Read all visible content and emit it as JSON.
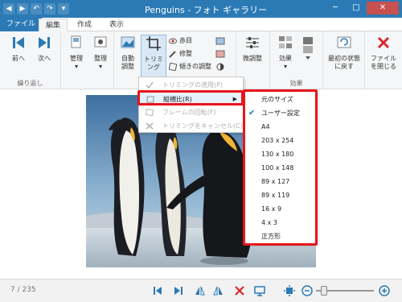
{
  "window": {
    "title": "Penguins - フォト ギャラリー",
    "minimize": "─",
    "maximize": "□",
    "close": "✕"
  },
  "qat": [
    "◀",
    "▶",
    "↶",
    "↷",
    "▾"
  ],
  "tabs": {
    "file": "ファイル",
    "edit": "編集",
    "create": "作成",
    "view": "表示"
  },
  "ribbon": {
    "prev": "前へ",
    "next": "次へ",
    "group_repeat": "繰り返し",
    "manage": "管理",
    "organize": "整理",
    "auto_adjust": "自動\n調整",
    "trim": "トリミ\nング",
    "red_eye": "赤目",
    "retouch": "修整",
    "straighten": "傾きの調整",
    "fine_tune": "微調整",
    "effects": "効果",
    "group_effects": "効果",
    "revert": "最初の状態\nに戻す",
    "close_file": "ファイル\nを閉じる"
  },
  "crop_menu": {
    "apply": "トリミングの適用(P)",
    "aspect": "縦横比(R)",
    "rotate_frame": "フレームの回転(F)",
    "cancel": "トリミングをキャンセル(C)"
  },
  "aspect_menu": {
    "items": [
      "元のサイズ",
      "ユーザー設定",
      "A4",
      "203 x 254",
      "130 x 180",
      "100 x 148",
      "89 x 127",
      "89 x 119",
      "16 x 9",
      "4 x 3",
      "正方形"
    ],
    "checked": "ユーザー設定"
  },
  "status": {
    "position": "7 / 235",
    "zoom_percent": 10
  },
  "colors": {
    "accent": "#2b7ab6",
    "highlight": "#e8141b"
  }
}
